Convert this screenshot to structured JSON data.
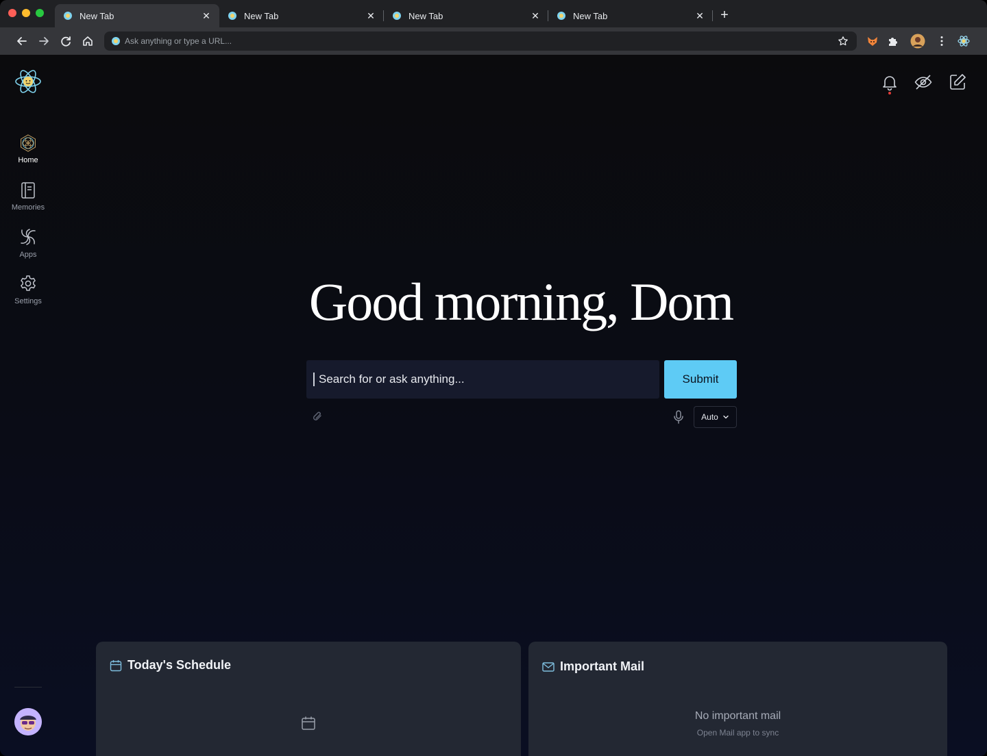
{
  "browser": {
    "tabs": [
      {
        "title": "New Tab",
        "active": true
      },
      {
        "title": "New Tab",
        "active": false
      },
      {
        "title": "New Tab",
        "active": false
      },
      {
        "title": "New Tab",
        "active": false
      }
    ],
    "omnibox_placeholder": "Ask anything or type a URL...",
    "icons": [
      "back-icon",
      "forward-icon",
      "reload-icon",
      "home-icon",
      "star-icon",
      "fox-extension-icon",
      "puzzle-extension-icon",
      "profile-avatar",
      "kebab-menu-icon",
      "atom-extension-icon"
    ]
  },
  "sidebar": {
    "items": [
      {
        "label": "Home",
        "icon": "home-mandala-icon",
        "active": true
      },
      {
        "label": "Memories",
        "icon": "notebook-icon",
        "active": false
      },
      {
        "label": "Apps",
        "icon": "swirl-icon",
        "active": false
      },
      {
        "label": "Settings",
        "icon": "gear-icon",
        "active": false
      }
    ]
  },
  "header": {
    "icons": [
      "bell-icon",
      "eye-off-icon",
      "edit-icon"
    ],
    "notification_color": "#e53935"
  },
  "main": {
    "greeting": "Good morning, Dom",
    "search_placeholder": "Search for or ask anything...",
    "submit_label": "Submit",
    "mode": "Auto"
  },
  "cards": {
    "schedule": {
      "title": "Today's Schedule"
    },
    "mail": {
      "title": "Important Mail",
      "empty_title": "No important mail",
      "empty_subtitle": "Open Mail app to sync"
    }
  },
  "colors": {
    "accent": "#5ecbf5",
    "card_bg": "#232833",
    "search_bg": "#161a2c"
  }
}
